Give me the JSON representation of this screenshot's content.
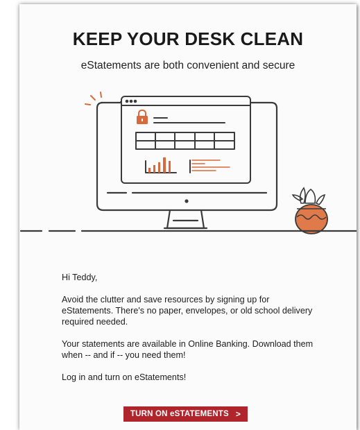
{
  "header": {
    "title": "KEEP YOUR DESK CLEAN",
    "subtitle": "eStatements are both convenient and secure"
  },
  "body": {
    "greeting": "Hi Teddy,",
    "paragraph1": "Avoid the clutter and save resources by signing up for eStatements. There's no paper, envelopes, or old school delivery required needed.",
    "paragraph2": "Your statements are available in Online Banking. Download them when -- and if -- you need them!",
    "paragraph3": "Log in and turn on eStatements!"
  },
  "cta": {
    "label": "TURN ON eSTATEMENTS",
    "chevron": ">"
  },
  "colors": {
    "accent": "#d9693a",
    "button": "#b0252b",
    "line": "#3a3a3a",
    "pot": "#e07a4a"
  },
  "icons": [
    "lock-icon",
    "bar-chart-icon",
    "computer-monitor-icon",
    "potted-plant-icon"
  ]
}
